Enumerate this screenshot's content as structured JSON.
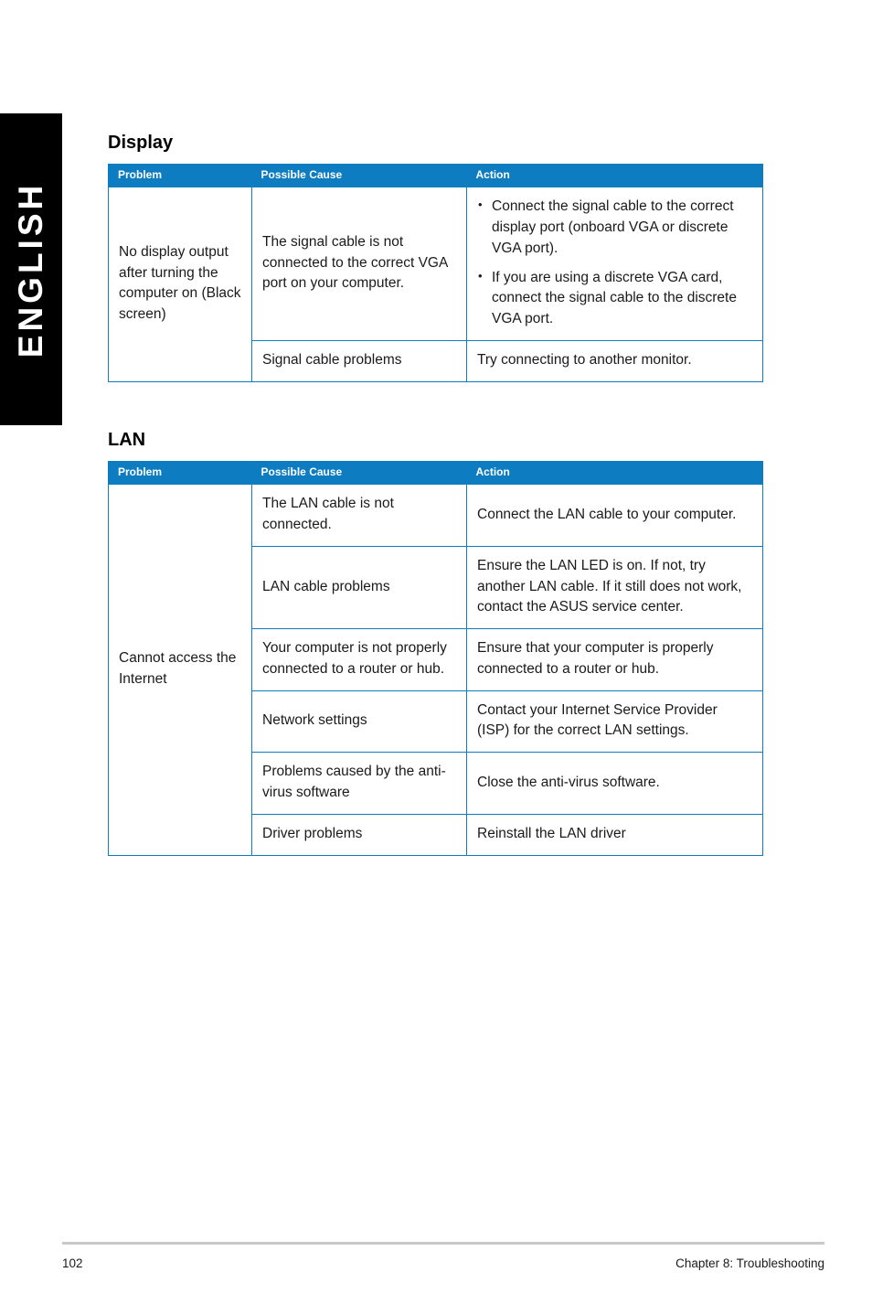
{
  "side_tab": {
    "label": "ENGLISH"
  },
  "sections": [
    {
      "id": "display",
      "heading": "Display",
      "table": {
        "headers": [
          "Problem",
          "Possible Cause",
          "Action"
        ],
        "rows": [
          {
            "problem": "No display output after turning the computer on (Black screen)",
            "cause": "The signal cable is not connected to the correct VGA port on your computer.",
            "action_bullets": [
              "Connect the signal cable to the correct display port (onboard VGA or discrete VGA port).",
              "If you are using a discrete VGA card, connect the signal cable to the discrete VGA port."
            ]
          },
          {
            "cause": "Signal cable problems",
            "action": "Try connecting to another monitor."
          }
        ]
      }
    },
    {
      "id": "lan",
      "heading": "LAN",
      "table": {
        "headers": [
          "Problem",
          "Possible Cause",
          "Action"
        ],
        "rows": [
          {
            "problem": "Cannot access the Internet",
            "cause": "The LAN cable is not connected.",
            "action": "Connect the LAN cable to your computer."
          },
          {
            "cause": "LAN cable problems",
            "action": "Ensure the LAN LED is on. If not, try another LAN cable. If it still does not work, contact the ASUS service center."
          },
          {
            "cause": "Your computer is not properly connected to a router or hub.",
            "action": "Ensure that your computer is properly connected to a router or hub."
          },
          {
            "cause": "Network settings",
            "action": "Contact your Internet Service Provider (ISP) for the correct LAN settings."
          },
          {
            "cause": "Problems caused by the anti-virus software",
            "action": "Close the anti-virus software."
          },
          {
            "cause": "Driver problems",
            "action": "Reinstall the LAN driver"
          }
        ]
      }
    }
  ],
  "footer": {
    "page_number": "102",
    "chapter": "Chapter 8: Troubleshooting"
  },
  "colors": {
    "table_accent": "#0e7cc0",
    "tab_background": "#000000",
    "footer_rule": "#c9c9c9"
  }
}
